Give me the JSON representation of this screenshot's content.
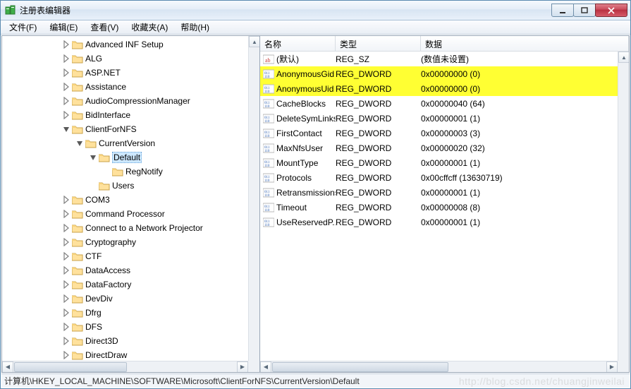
{
  "window": {
    "title": "注册表编辑器"
  },
  "menu": {
    "file": "文件(F)",
    "edit": "编辑(E)",
    "view": "查看(V)",
    "favorites": "收藏夹(A)",
    "help": "帮助(H)"
  },
  "tree": {
    "items": [
      {
        "indent": 84,
        "expander": "closed",
        "label": "Advanced INF Setup"
      },
      {
        "indent": 84,
        "expander": "closed",
        "label": "ALG"
      },
      {
        "indent": 84,
        "expander": "closed",
        "label": "ASP.NET"
      },
      {
        "indent": 84,
        "expander": "closed",
        "label": "Assistance"
      },
      {
        "indent": 84,
        "expander": "closed",
        "label": "AudioCompressionManager"
      },
      {
        "indent": 84,
        "expander": "closed",
        "label": "BidInterface"
      },
      {
        "indent": 84,
        "expander": "open",
        "label": "ClientForNFS"
      },
      {
        "indent": 103,
        "expander": "open",
        "label": "CurrentVersion"
      },
      {
        "indent": 122,
        "expander": "open",
        "label": "Default",
        "selected": true
      },
      {
        "indent": 141,
        "expander": "none",
        "label": "RegNotify"
      },
      {
        "indent": 122,
        "expander": "none",
        "label": "Users"
      },
      {
        "indent": 84,
        "expander": "closed",
        "label": "COM3"
      },
      {
        "indent": 84,
        "expander": "closed",
        "label": "Command Processor"
      },
      {
        "indent": 84,
        "expander": "closed",
        "label": "Connect to a Network Projector"
      },
      {
        "indent": 84,
        "expander": "closed",
        "label": "Cryptography"
      },
      {
        "indent": 84,
        "expander": "closed",
        "label": "CTF"
      },
      {
        "indent": 84,
        "expander": "closed",
        "label": "DataAccess"
      },
      {
        "indent": 84,
        "expander": "closed",
        "label": "DataFactory"
      },
      {
        "indent": 84,
        "expander": "closed",
        "label": "DevDiv"
      },
      {
        "indent": 84,
        "expander": "closed",
        "label": "Dfrg"
      },
      {
        "indent": 84,
        "expander": "closed",
        "label": "DFS"
      },
      {
        "indent": 84,
        "expander": "closed",
        "label": "Direct3D"
      },
      {
        "indent": 84,
        "expander": "closed",
        "label": "DirectDraw"
      }
    ]
  },
  "list": {
    "headers": {
      "name": "名称",
      "type": "类型",
      "data": "数据"
    },
    "rows": [
      {
        "icon": "sz",
        "name": "(默认)",
        "type": "REG_SZ",
        "data": "(数值未设置)",
        "highlight": false
      },
      {
        "icon": "dw",
        "name": "AnonymousGid",
        "type": "REG_DWORD",
        "data": "0x00000000 (0)",
        "highlight": true
      },
      {
        "icon": "dw",
        "name": "AnonymousUid",
        "type": "REG_DWORD",
        "data": "0x00000000 (0)",
        "highlight": true
      },
      {
        "icon": "dw",
        "name": "CacheBlocks",
        "type": "REG_DWORD",
        "data": "0x00000040 (64)",
        "highlight": false
      },
      {
        "icon": "dw",
        "name": "DeleteSymLinks",
        "type": "REG_DWORD",
        "data": "0x00000001 (1)",
        "highlight": false
      },
      {
        "icon": "dw",
        "name": "FirstContact",
        "type": "REG_DWORD",
        "data": "0x00000003 (3)",
        "highlight": false
      },
      {
        "icon": "dw",
        "name": "MaxNfsUser",
        "type": "REG_DWORD",
        "data": "0x00000020 (32)",
        "highlight": false
      },
      {
        "icon": "dw",
        "name": "MountType",
        "type": "REG_DWORD",
        "data": "0x00000001 (1)",
        "highlight": false
      },
      {
        "icon": "dw",
        "name": "Protocols",
        "type": "REG_DWORD",
        "data": "0x00cffcff (13630719)",
        "highlight": false
      },
      {
        "icon": "dw",
        "name": "Retransmissions",
        "type": "REG_DWORD",
        "data": "0x00000001 (1)",
        "highlight": false
      },
      {
        "icon": "dw",
        "name": "Timeout",
        "type": "REG_DWORD",
        "data": "0x00000008 (8)",
        "highlight": false
      },
      {
        "icon": "dw",
        "name": "UseReservedP...",
        "type": "REG_DWORD",
        "data": "0x00000001 (1)",
        "highlight": false
      }
    ]
  },
  "statusbar": {
    "path": "计算机\\HKEY_LOCAL_MACHINE\\SOFTWARE\\Microsoft\\ClientForNFS\\CurrentVersion\\Default"
  },
  "watermark": "http://blog.csdn.net/chuangjinweilai"
}
